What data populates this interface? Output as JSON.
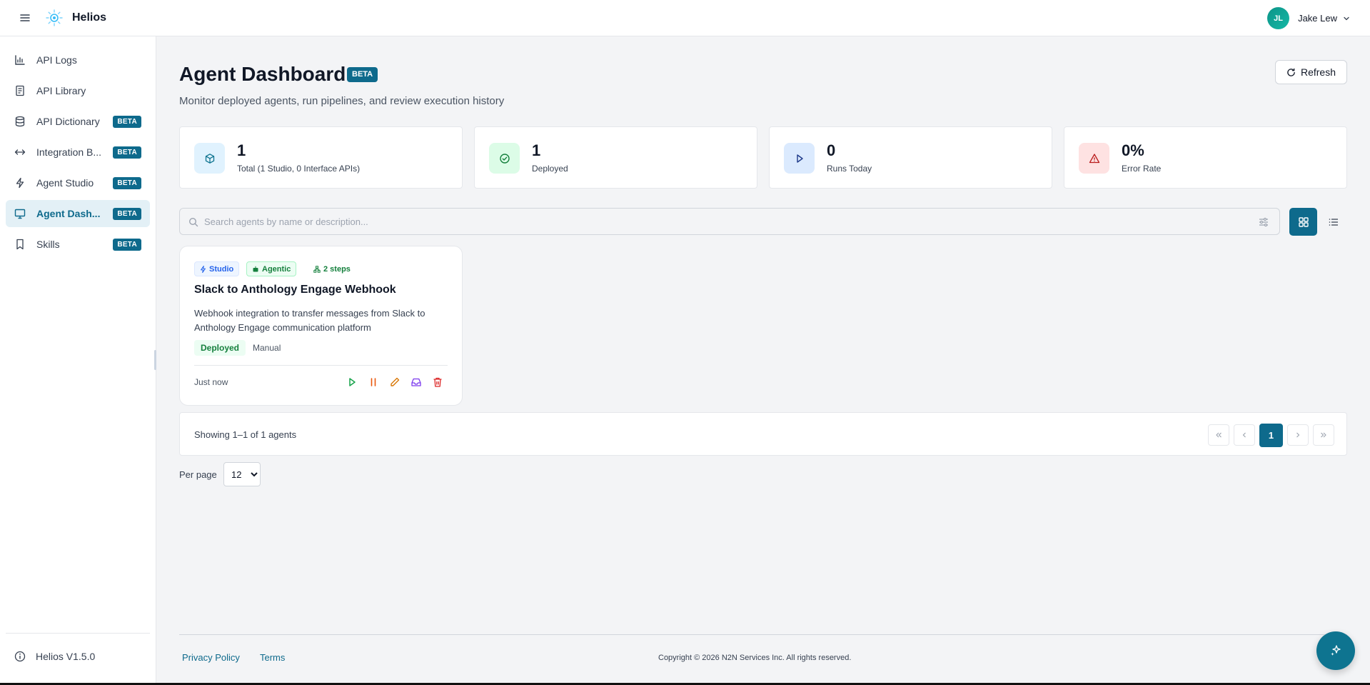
{
  "header": {
    "brand": "Helios",
    "user": {
      "initials": "JL",
      "name": "Jake Lew"
    }
  },
  "sidebar": {
    "items": [
      {
        "label": "API Logs",
        "icon": "bar-chart-icon",
        "badge": ""
      },
      {
        "label": "API Library",
        "icon": "book-icon",
        "badge": ""
      },
      {
        "label": "API Dictionary",
        "icon": "database-icon",
        "badge": "BETA"
      },
      {
        "label": "Integration B...",
        "icon": "arrows-horizontal-icon",
        "badge": "BETA"
      },
      {
        "label": "Agent Studio",
        "icon": "lightning-icon",
        "badge": "BETA"
      },
      {
        "label": "Agent Dash...",
        "icon": "monitor-icon",
        "badge": "BETA",
        "active": true
      },
      {
        "label": "Skills",
        "icon": "bookmark-icon",
        "badge": "BETA"
      }
    ],
    "version": "Helios V1.5.0"
  },
  "page": {
    "title": "Agent Dashboard",
    "title_badge": "BETA",
    "subtitle": "Monitor deployed agents, run pipelines, and review execution history",
    "refresh_label": "Refresh"
  },
  "stats": [
    {
      "value": "1",
      "label": "Total (1 Studio, 0 Interface APIs)",
      "color": "#0e7490",
      "bg": "#e0f2fe"
    },
    {
      "value": "1",
      "label": "Deployed",
      "color": "#15803d",
      "bg": "#dcfce7"
    },
    {
      "value": "0",
      "label": "Runs Today",
      "color": "#1e3a8a",
      "bg": "#dbeafe"
    },
    {
      "value": "0%",
      "label": "Error Rate",
      "color": "#b91c1c",
      "bg": "#fee2e2"
    }
  ],
  "search": {
    "placeholder": "Search agents by name or description...",
    "value": ""
  },
  "agents": [
    {
      "tags": {
        "studio": "Studio",
        "agentic": "Agentic",
        "steps": "2 steps"
      },
      "title": "Slack to Anthology Engage Webhook",
      "description": "Webhook integration to transfer messages from Slack to Anthology Engage communication platform",
      "status": "Deployed",
      "trigger": "Manual",
      "updated": "Just now"
    }
  ],
  "pagination": {
    "summary": "Showing 1–1 of 1 agents",
    "current_page": "1",
    "per_page_label": "Per page",
    "per_page": "12"
  },
  "footer": {
    "privacy": "Privacy Policy",
    "terms": "Terms",
    "copyright": "Copyright © 2026 N2N Services Inc. All rights reserved."
  },
  "colors": {
    "accent": "#0e6a8c",
    "active_bg": "#e3f0f6"
  }
}
